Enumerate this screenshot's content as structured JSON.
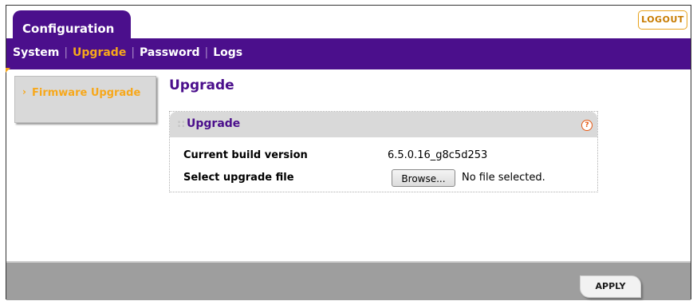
{
  "header": {
    "config_tab": "Configuration",
    "logout": "LOGOUT"
  },
  "nav": {
    "items": [
      "System",
      "Upgrade",
      "Password",
      "Logs"
    ],
    "active": "Upgrade"
  },
  "sidebar": {
    "arrow": "›",
    "item": "Firmware Upgrade"
  },
  "main": {
    "title": "Upgrade",
    "panel": {
      "title": "Upgrade",
      "help": "?",
      "build_label": "Current build version",
      "build_value": "6.5.0.16_g8c5d253",
      "file_label": "Select upgrade file",
      "browse": "Browse...",
      "file_status": "No file selected."
    }
  },
  "footer": {
    "apply": "APPLY"
  },
  "colors": {
    "brand_purple": "#4b0f8c",
    "accent_orange": "#f7a81b",
    "footer_gray": "#9e9e9e"
  }
}
